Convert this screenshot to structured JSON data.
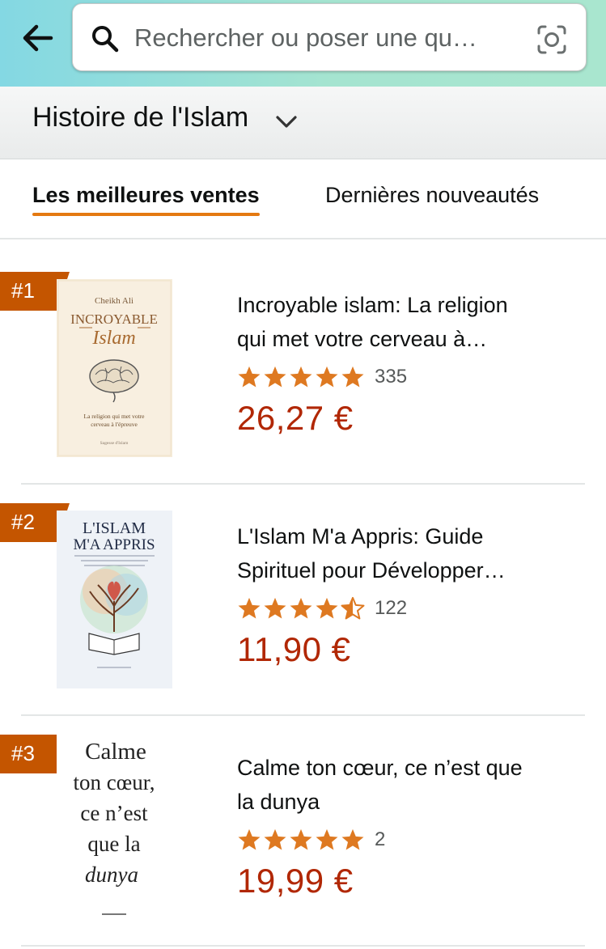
{
  "search": {
    "placeholder": "Rechercher ou poser une qu…"
  },
  "category": {
    "title": "Histoire de l'Islam"
  },
  "tabs": [
    {
      "label": "Les meilleures ventes",
      "active": true
    },
    {
      "label": "Dernières nouveautés",
      "active": false
    }
  ],
  "items": [
    {
      "rank": "#1",
      "title_line1": "Incroyable islam: La religion",
      "title_line2": "qui met votre cerveau à…",
      "rating": 5,
      "review_count": "335",
      "price": "26,27 €",
      "cover": {
        "author": "Cheikh Ali",
        "line1": "INCROYABLE",
        "line2": "Islam",
        "subtitle1": "La religion qui met votre",
        "subtitle2": "cerveau à l'épreuve",
        "publisher": "Sagesse d'Islam"
      }
    },
    {
      "rank": "#2",
      "title_line1": "L'Islam M'a Appris: Guide",
      "title_line2": "Spirituel pour Développer…",
      "rating": 4.5,
      "review_count": "122",
      "price": "11,90 €",
      "cover": {
        "line1": "L'ISLAM",
        "line2": "M'A APPRIS"
      }
    },
    {
      "rank": "#3",
      "title_line1": "Calme ton cœur, ce n’est que",
      "title_line2": "la dunya",
      "rating": 5,
      "review_count": "2",
      "price": "19,99 €",
      "cover": {
        "line1": "Calme",
        "line2": "ton cœur,",
        "line3": "ce n’est",
        "line4": "que la",
        "line5": "dunya"
      }
    }
  ],
  "colors": {
    "accent": "#e47911",
    "badge": "#c45500",
    "price": "#b12704",
    "star": "#de7921"
  },
  "icons": {
    "back": "arrow-left-icon",
    "search": "search-icon",
    "lens": "camera-lens-icon",
    "chevron": "chevron-down-icon",
    "star": "star-icon"
  }
}
